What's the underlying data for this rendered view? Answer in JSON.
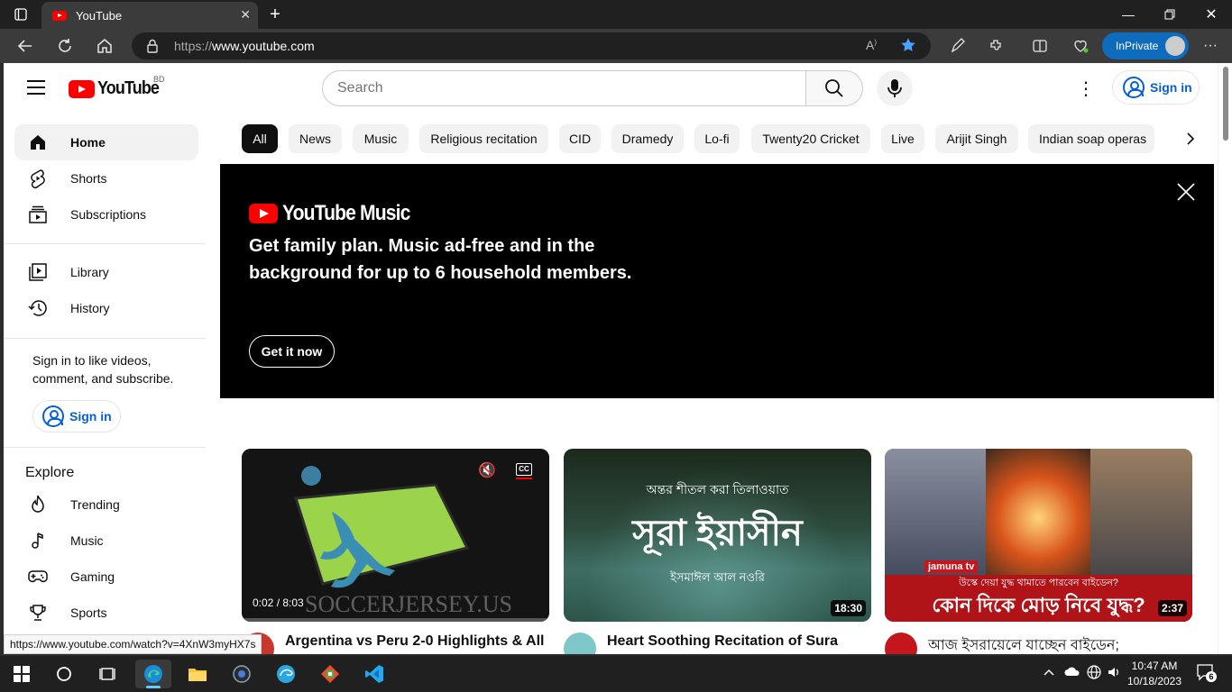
{
  "browser": {
    "tab_title": "YouTube",
    "url_prefix": "https://",
    "url_domain": "www.youtube.com",
    "inprivate_label": "InPrivate",
    "status_url": "https://www.youtube.com/watch?v=4XnW3myHX7s"
  },
  "header": {
    "logo_text": "YouTube",
    "country_code": "BD",
    "search_placeholder": "Search",
    "signin_label": "Sign in"
  },
  "sidebar": {
    "items": [
      {
        "label": "Home",
        "icon": "home-icon"
      },
      {
        "label": "Shorts",
        "icon": "shorts-icon"
      },
      {
        "label": "Subscriptions",
        "icon": "subscriptions-icon"
      },
      {
        "label": "Library",
        "icon": "library-icon"
      },
      {
        "label": "History",
        "icon": "history-icon"
      }
    ],
    "signin_prompt": "Sign in to like videos, comment, and subscribe.",
    "signin_label": "Sign in",
    "explore_heading": "Explore",
    "explore_items": [
      {
        "label": "Trending",
        "icon": "trending-icon"
      },
      {
        "label": "Music",
        "icon": "music-icon"
      },
      {
        "label": "Gaming",
        "icon": "gaming-icon"
      },
      {
        "label": "Sports",
        "icon": "sports-icon"
      }
    ]
  },
  "chips": [
    "All",
    "News",
    "Music",
    "Religious recitation",
    "CID",
    "Dramedy",
    "Lo-fi",
    "Twenty20 Cricket",
    "Live",
    "Arijit Singh",
    "Indian soap operas"
  ],
  "banner": {
    "logo_text": "YouTube Music",
    "headline": "Get family plan. Music ad-free and in the background for up to 6 household members.",
    "cta_label": "Get it now"
  },
  "videos": [
    {
      "title": "Argentina vs Peru 2-0 Highlights & All",
      "time_progress": "0:02 / 8:03",
      "overlay_text": "SOCCERJERSEY.US",
      "channel_avatar": "red"
    },
    {
      "title": "Heart Soothing Recitation of Sura",
      "duration": "18:30",
      "overlay_line1": "অন্তর শীতল করা তিলাওয়াত",
      "overlay_big": "সূরা ইয়াসীন",
      "overlay_line2": "ইসমাঈল আল নওরি",
      "channel_avatar": "teal"
    },
    {
      "title": "আজ ইসরায়েলে যাচ্ছেন বাইডেন;",
      "duration": "2:37",
      "brand": "jamuna tv",
      "overlay_small": "উস্কে দেয়া যুদ্ধ থামাতে পারবেন বাইডেন?",
      "overlay_big": "কোন দিকে মোড় নিবে যুদ্ধ?",
      "channel_avatar": "jamuna-red"
    }
  ],
  "taskbar": {
    "time": "10:47 AM",
    "date": "10/18/2023",
    "notification_count": "6"
  }
}
